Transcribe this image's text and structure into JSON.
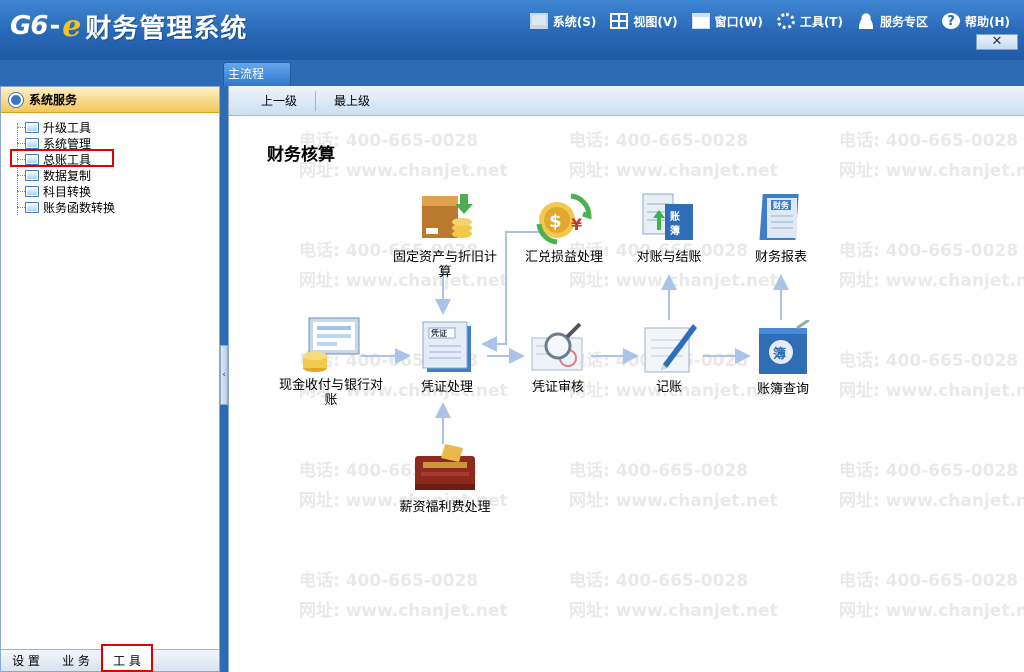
{
  "app": {
    "logo_g6": "G6",
    "logo_dash": "-",
    "logo_e": "e",
    "logo_name": "财务管理系统"
  },
  "menu": [
    {
      "label": "系统(S)",
      "icon": "monitor-icon"
    },
    {
      "label": "视图(V)",
      "icon": "grid-icon"
    },
    {
      "label": "窗口(W)",
      "icon": "window-icon"
    },
    {
      "label": "工具(T)",
      "icon": "gear-icon"
    },
    {
      "label": "服务专区",
      "icon": "user-icon"
    },
    {
      "label": "帮助(H)",
      "icon": "help-icon"
    }
  ],
  "close_label": "✕",
  "left_panel": {
    "header": "系统服务",
    "tree": [
      "升级工具",
      "系统管理",
      "总账工具",
      "数据复制",
      "科目转换",
      "账务函数转换"
    ],
    "tabs": [
      "设 置",
      "业 务",
      "工 具"
    ],
    "active_tab": "工 具",
    "collapse_glyph": "‹"
  },
  "main_tab": "主流程",
  "toolbar": {
    "up_label": "上一级",
    "top_label": "最上级"
  },
  "section_title": "财务核算",
  "watermark": {
    "phone": "电话: 400-665-0028",
    "site": "网址: www.chanjet.net"
  },
  "nodes": {
    "fixed_assets": "固定资产与折旧计算",
    "fx": "汇兑损益处理",
    "reconcile": "对账与结账",
    "reports": "财务报表",
    "cash": "现金收付与银行对账",
    "voucher": "凭证处理",
    "audit": "凭证审核",
    "post": "记账",
    "ledger": "账簿查询",
    "payroll": "薪资福利费处理"
  },
  "colors": {
    "title_blue": "#2868b6",
    "header_gold": "#f4c65a",
    "highlight_red": "#e00000",
    "arrow_blue": "#a9c4e6"
  }
}
